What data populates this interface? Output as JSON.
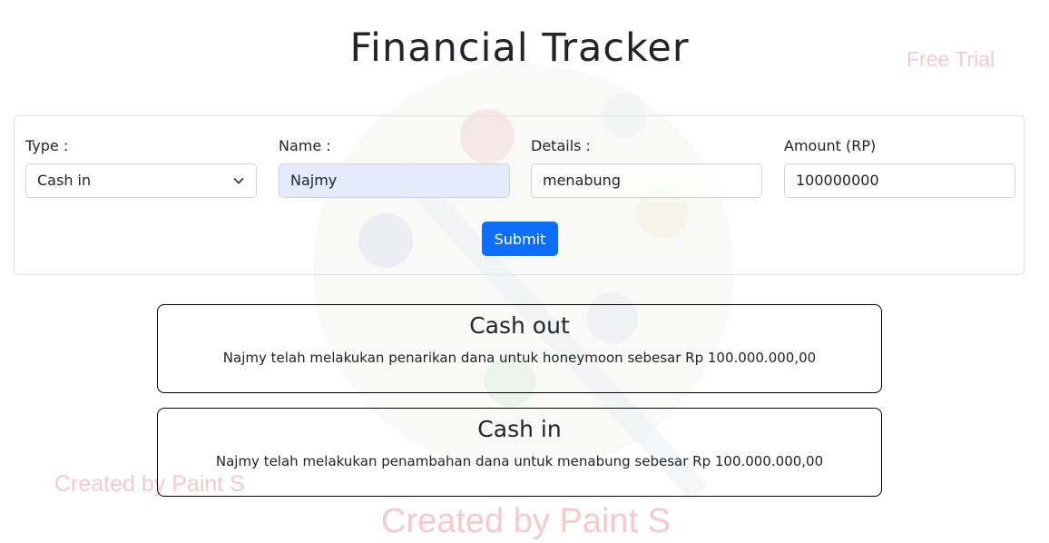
{
  "page": {
    "title": "Financial Tracker"
  },
  "watermarks": {
    "free_trial": "Free Trial",
    "created_by": "Created by Paint S"
  },
  "form": {
    "type": {
      "label": "Type :",
      "value": "Cash in"
    },
    "name": {
      "label": "Name :",
      "value": "Najmy"
    },
    "details": {
      "label": "Details :",
      "value": "menabung"
    },
    "amount": {
      "label": "Amount (RP)",
      "value": "100000000"
    },
    "submit_label": "Submit"
  },
  "transactions": [
    {
      "type": "Cash out",
      "description": "Najmy telah melakukan penarikan dana untuk honeymoon sebesar Rp 100.000.000,00"
    },
    {
      "type": "Cash in",
      "description": "Najmy telah melakukan penambahan dana untuk menabung sebesar Rp 100.000.000,00"
    }
  ],
  "colors": {
    "primary": "#0d6efd",
    "watermark": "#f6c9cc",
    "filled_input": "#e3ebfb"
  }
}
